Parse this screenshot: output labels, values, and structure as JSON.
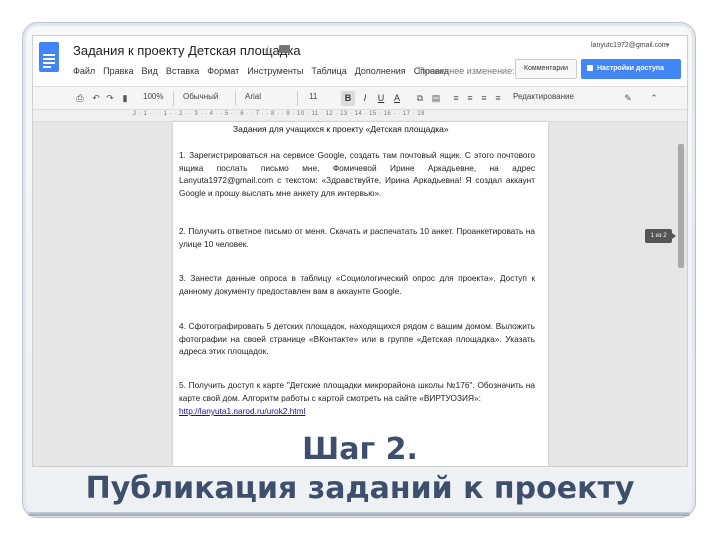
{
  "header": {
    "doc_title": "Задания к проекту Детская площадка",
    "account": "lanyutc1972@gmail.com",
    "menu": [
      "Файл",
      "Правка",
      "Вид",
      "Вставка",
      "Формат",
      "Инструменты",
      "Таблица",
      "Дополнения",
      "Справка"
    ],
    "last_edit": "Последнее изменение: 28 н",
    "comments_label": "Комментарии",
    "share_label": "Настройки доступа"
  },
  "toolbar": {
    "zoom": "100%",
    "style": "Обычный",
    "font": "Arial",
    "size": "11",
    "bold": "B",
    "italic": "I",
    "underline": "U",
    "text_color": "A",
    "mode": "Редактирование"
  },
  "ruler": "2 · 1 · · · 1 · · 2 · · 3 · · 4 · · 5 · · 6 · · 7 · · 8 · · 9 · 10 · 11 · 12 · 13 · 14 · 15 · 16 · · 17 · 18",
  "document": {
    "heading": "Задания для учащихся к проекту «Детская площадка»",
    "p1": "1. Зарегистрироваться на сервисе Google, создать там почтовый ящик. С этого почтового ящика послать письмо мне, Фомичевой Ирине Аркадьевне, на адрес Lanyuta1972@gmail.com с текстом: «Здравствуйте, Ирина Аркадьевна! Я создал аккаунт Google и прошу выслать мне анкету для интервью».",
    "p2": "2. Получить ответное письмо от меня. Скачать и распечатать 10 анкет. Проанкетировать на улице 10 человек.",
    "p3": "3. Занести данные опроса в таблицу «Социологический опрос для проекта». Доступ к данному документу предоставлен вам в аккаунте Google.",
    "p4": "4. Сфотографировать 5 детских площадок, находящихся рядом с вашим домом. Выложить фотографии на своей странице «ВКонтакте» или в группе «Детская площадка». Указать адреса этих площадок.",
    "p5": "5. Получить доступ к карте \"Детские площадки микрорайона школы №176\". Обозначить на карте свой дом. Алгоритм работы с картой смотреть на сайте «ВИРТУОЗИЯ»:",
    "p5_link": "http://lanyuta1.narod.ru/urok2.html",
    "page_indicator": "1 из 2"
  },
  "slide": {
    "title": "Шаг 2.",
    "subtitle": "Публикация заданий к проекту"
  },
  "icons": [
    "docs-logo-icon",
    "star-icon",
    "folder-icon",
    "print-icon",
    "undo-icon",
    "redo-icon",
    "paint-format-icon",
    "pen-icon",
    "collapse-icon",
    "lock-icon"
  ],
  "colors": {
    "docs_blue": "#4285f4",
    "title_color": "#3e4f6b",
    "link": "#1a0dab"
  }
}
